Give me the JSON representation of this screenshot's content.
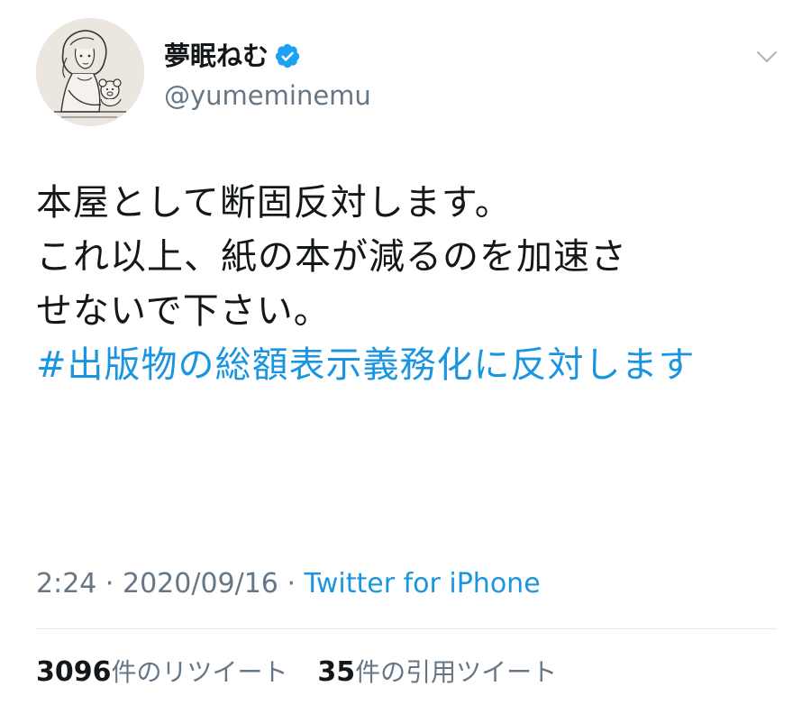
{
  "user": {
    "display_name": "夢眠ねむ",
    "username": "@yumeminemu",
    "avatar_icon": "avatar-illustration-icon",
    "verified_icon": "verified-badge-icon"
  },
  "tweet": {
    "lines": [
      "本屋として断固反対します。",
      "これ以上、紙の本が減るのを加速さ",
      "せないで下さい。"
    ],
    "hashtag": "#出版物の総額表示義務化に反対します"
  },
  "meta": {
    "time": "2:24",
    "separator": " · ",
    "date": "2020/09/16",
    "source": "Twitter for iPhone"
  },
  "stats": {
    "retweets_count": "3096",
    "retweets_label": "件のリツイート",
    "quotes_count": "35",
    "quotes_label": "件の引用ツイート"
  },
  "colors": {
    "link": "#1b95e0",
    "secondary": "#657786",
    "primary": "#14171a",
    "divider": "#e1e8ed"
  }
}
